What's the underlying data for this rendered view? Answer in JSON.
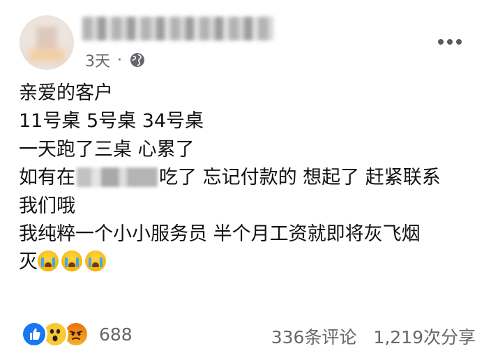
{
  "header": {
    "time": "3天",
    "separator": "·",
    "privacy_icon": "globe-icon",
    "more_icon": "more-icon"
  },
  "post": {
    "lines": [
      "亲爱的客户",
      "11号桌 5号桌 34号桌",
      "一天跑了三桌 心累了",
      "吃了 忘记付款的 想起了 赶紧联系",
      "我们哦",
      "我纯粹一个小小服务员 半个月工资就即将灰飞烟",
      "灭"
    ],
    "line4_prefix": "如有在",
    "emoji_name": "loudly-crying-face-icon"
  },
  "footer": {
    "reaction_icons": [
      "like-icon",
      "wow-icon",
      "angry-icon"
    ],
    "reaction_count": "688",
    "comments": "336条评论",
    "shares": "1,219次分享"
  }
}
